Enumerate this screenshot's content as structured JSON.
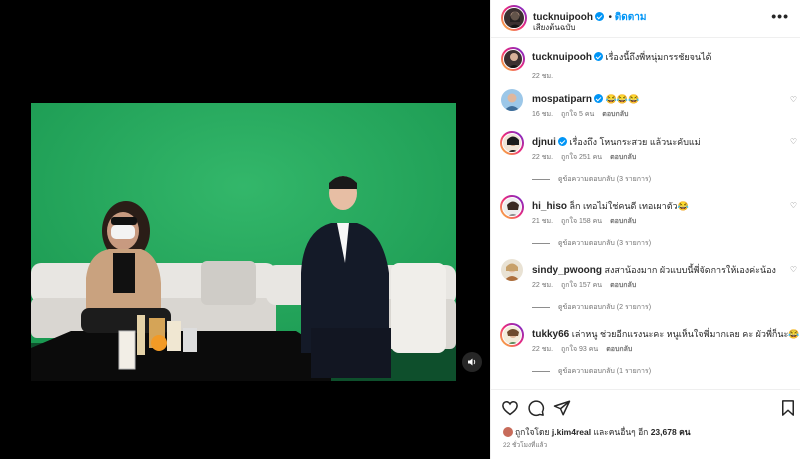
{
  "post": {
    "author": "tucknuipooh",
    "follow_label": "ติดตาม",
    "audio_label": "เสียงต้นฉบับ",
    "caption": "เรื่องนี้ถึงพี่หนุ่มกรรชัยจนได้",
    "caption_time": "22 ชม.",
    "likes_prefix": "ถูกใจโดย",
    "liked_by": "j.kim4real",
    "likes_mid": "และคนอื่นๆ อีก",
    "likes_count": "23,678 คน",
    "posted_ago": "22 ชั่วโมงที่แล้ว"
  },
  "comments": [
    {
      "user": "mospatiparn",
      "verified": true,
      "text": "😂😂😂",
      "time": "16 ชม.",
      "likes": "ถูกใจ 5 คน",
      "reply": "ตอบกลับ",
      "view_replies": ""
    },
    {
      "user": "djnui",
      "verified": true,
      "text": "เรื่องถึง โหนกระสวย แล้วนะคับแม่",
      "time": "22 ชม.",
      "likes": "ถูกใจ 251 คน",
      "reply": "ตอบกลับ",
      "view_replies": "ดูข้อความตอบกลับ (3 รายการ)"
    },
    {
      "user": "hi_hiso",
      "verified": false,
      "text": "ล็ก เทอไม่ใช่คนดี เทอเผาตัว😂",
      "time": "21 ชม.",
      "likes": "ถูกใจ 158 คน",
      "reply": "ตอบกลับ",
      "view_replies": "ดูข้อความตอบกลับ (3 รายการ)"
    },
    {
      "user": "sindy_pwoong",
      "verified": false,
      "text": "สงสาน้องมาก ผัวแบบนี้พี่จัดการให้เองค่ะน้อง",
      "time": "22 ชม.",
      "likes": "ถูกใจ 157 คน",
      "reply": "ตอบกลับ",
      "view_replies": "ดูข้อความตอบกลับ (2 รายการ)"
    },
    {
      "user": "tukky66",
      "verified": false,
      "text": "เล่าหนู ช่วยอีกแรงนะคะ หนูเห็นใจพี่มากเลย คะ ผัวพี่ก็นะ😂",
      "time": "22 ชม.",
      "likes": "ถูกใจ 93 คน",
      "reply": "ตอบกลับ",
      "view_replies": "ดูข้อความตอบกลับ (1 รายการ)"
    }
  ],
  "icons": [
    "more-icon",
    "heart-icon",
    "comment-icon",
    "share-icon",
    "bookmark-icon",
    "mute-icon",
    "verified-icon"
  ],
  "colors": {
    "accent": "#0095f6",
    "green_screen": "#1fa85a",
    "text": "#262626",
    "muted": "#737373"
  }
}
